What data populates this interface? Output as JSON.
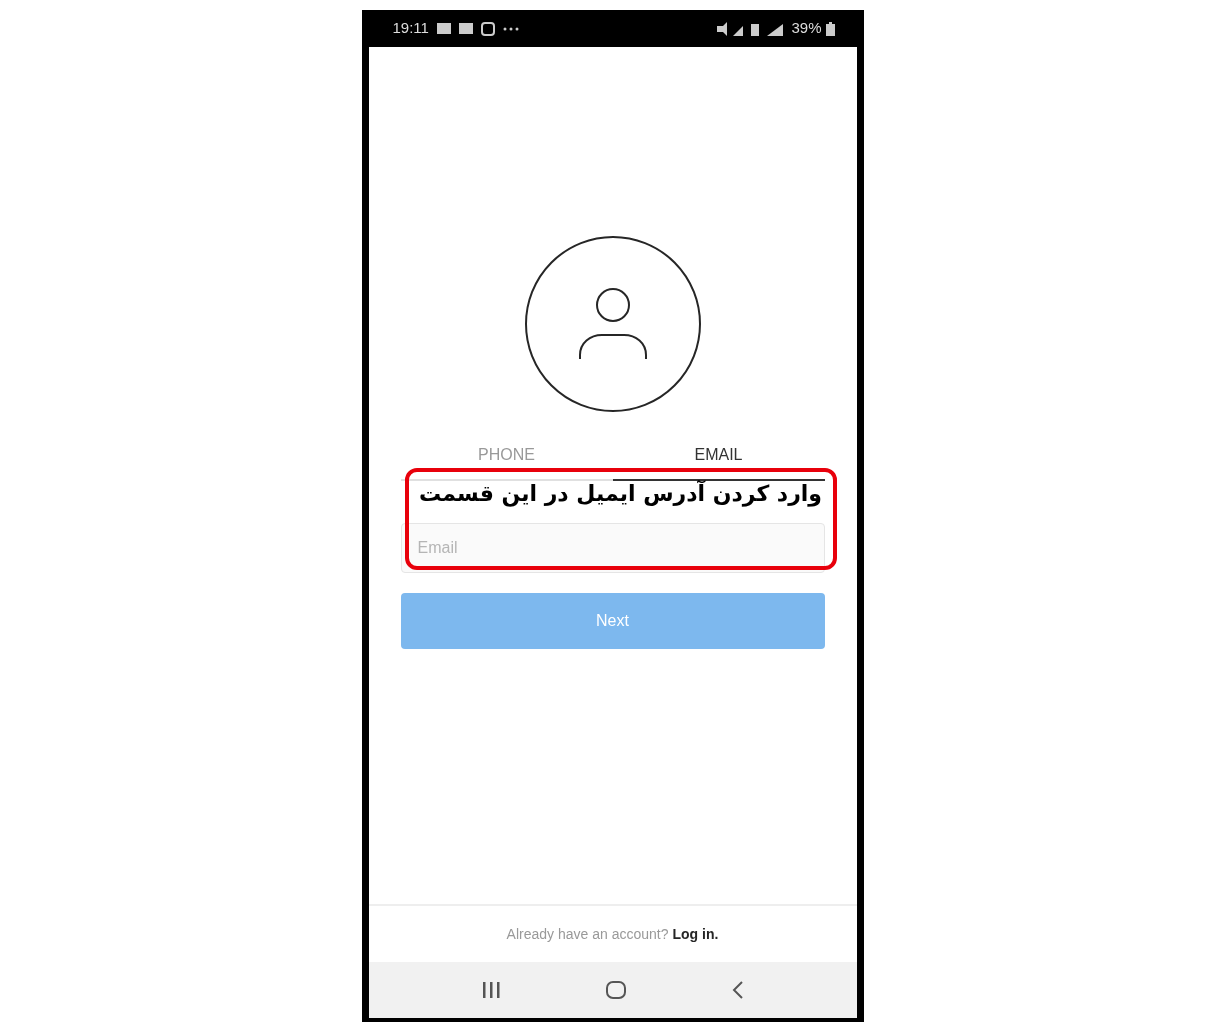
{
  "status_bar": {
    "time": "19:11",
    "battery": "39%"
  },
  "tabs": [
    {
      "label": "PHONE",
      "selected": false
    },
    {
      "label": "EMAIL",
      "selected": true
    }
  ],
  "email_field": {
    "placeholder": "Email"
  },
  "next_button": {
    "label": "Next",
    "disabled": true
  },
  "annotation": {
    "text": "وارد کردن آدرس ایمیل در این قسمت"
  },
  "footer": {
    "text": "Already have an account?",
    "link": "Log in."
  }
}
